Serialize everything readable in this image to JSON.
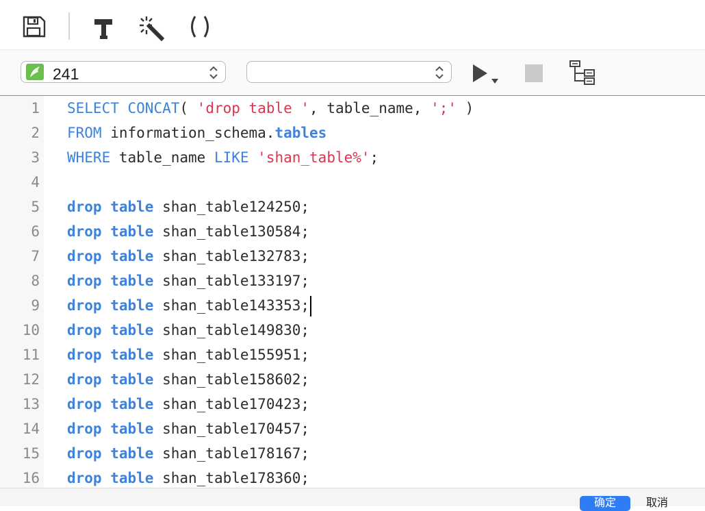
{
  "toolbar": {
    "buttons": [
      {
        "icon": "save-icon"
      },
      {
        "icon": "hammer-icon"
      },
      {
        "icon": "magic-wand-icon"
      },
      {
        "icon": "parentheses-icon"
      }
    ]
  },
  "connection_bar": {
    "database_value": "241",
    "database_icon": "database-icon",
    "schema_value": "",
    "run_icon": "play-icon",
    "stop_icon": "stop-icon",
    "explain_icon": "explain-plan-icon"
  },
  "editor": {
    "colors": {
      "keyword": "#3d82dc",
      "string": "#d9364f",
      "text": "#2b2b2b",
      "line_number": "#8a8a8a"
    },
    "lines": [
      {
        "n": "1",
        "tokens": [
          {
            "t": "SELECT",
            "c": "kw"
          },
          {
            "t": " "
          },
          {
            "t": "CONCAT",
            "c": "kw"
          },
          {
            "t": "( "
          },
          {
            "t": "'drop table '",
            "c": "str"
          },
          {
            "t": ", table_name, "
          },
          {
            "t": "';'",
            "c": "str"
          },
          {
            "t": " )"
          }
        ]
      },
      {
        "n": "2",
        "tokens": [
          {
            "t": "FROM",
            "c": "kw"
          },
          {
            "t": " information_schema."
          },
          {
            "t": "tables",
            "c": "kwb"
          }
        ]
      },
      {
        "n": "3",
        "tokens": [
          {
            "t": "WHERE",
            "c": "kw"
          },
          {
            "t": " table_name "
          },
          {
            "t": "LIKE",
            "c": "kw"
          },
          {
            "t": " "
          },
          {
            "t": "'shan_table%'",
            "c": "str"
          },
          {
            "t": ";"
          }
        ]
      },
      {
        "n": "4",
        "tokens": []
      },
      {
        "n": "5",
        "tokens": [
          {
            "t": "drop",
            "c": "kwb"
          },
          {
            "t": " "
          },
          {
            "t": "table",
            "c": "kwb"
          },
          {
            "t": " shan_table124250;"
          }
        ]
      },
      {
        "n": "6",
        "tokens": [
          {
            "t": "drop",
            "c": "kwb"
          },
          {
            "t": " "
          },
          {
            "t": "table",
            "c": "kwb"
          },
          {
            "t": " shan_table130584;"
          }
        ]
      },
      {
        "n": "7",
        "tokens": [
          {
            "t": "drop",
            "c": "kwb"
          },
          {
            "t": " "
          },
          {
            "t": "table",
            "c": "kwb"
          },
          {
            "t": " shan_table132783;"
          }
        ]
      },
      {
        "n": "8",
        "tokens": [
          {
            "t": "drop",
            "c": "kwb"
          },
          {
            "t": " "
          },
          {
            "t": "table",
            "c": "kwb"
          },
          {
            "t": " shan_table133197;"
          }
        ]
      },
      {
        "n": "9",
        "tokens": [
          {
            "t": "drop",
            "c": "kwb"
          },
          {
            "t": " "
          },
          {
            "t": "table",
            "c": "kwb"
          },
          {
            "t": " shan_table143353;"
          }
        ],
        "cursor": true
      },
      {
        "n": "10",
        "tokens": [
          {
            "t": "drop",
            "c": "kwb"
          },
          {
            "t": " "
          },
          {
            "t": "table",
            "c": "kwb"
          },
          {
            "t": " shan_table149830;"
          }
        ]
      },
      {
        "n": "11",
        "tokens": [
          {
            "t": "drop",
            "c": "kwb"
          },
          {
            "t": " "
          },
          {
            "t": "table",
            "c": "kwb"
          },
          {
            "t": " shan_table155951;"
          }
        ]
      },
      {
        "n": "12",
        "tokens": [
          {
            "t": "drop",
            "c": "kwb"
          },
          {
            "t": " "
          },
          {
            "t": "table",
            "c": "kwb"
          },
          {
            "t": " shan_table158602;"
          }
        ]
      },
      {
        "n": "13",
        "tokens": [
          {
            "t": "drop",
            "c": "kwb"
          },
          {
            "t": " "
          },
          {
            "t": "table",
            "c": "kwb"
          },
          {
            "t": " shan_table170423;"
          }
        ]
      },
      {
        "n": "14",
        "tokens": [
          {
            "t": "drop",
            "c": "kwb"
          },
          {
            "t": " "
          },
          {
            "t": "table",
            "c": "kwb"
          },
          {
            "t": " shan_table170457;"
          }
        ]
      },
      {
        "n": "15",
        "tokens": [
          {
            "t": "drop",
            "c": "kwb"
          },
          {
            "t": " "
          },
          {
            "t": "table",
            "c": "kwb"
          },
          {
            "t": " shan_table178167;"
          }
        ]
      },
      {
        "n": "16",
        "tokens": [
          {
            "t": "drop",
            "c": "kwb"
          },
          {
            "t": " "
          },
          {
            "t": "table",
            "c": "kwb"
          },
          {
            "t": " shan_table178360;"
          }
        ]
      }
    ]
  },
  "footer": {
    "ok_label": "确定",
    "cancel_label": "取消"
  }
}
